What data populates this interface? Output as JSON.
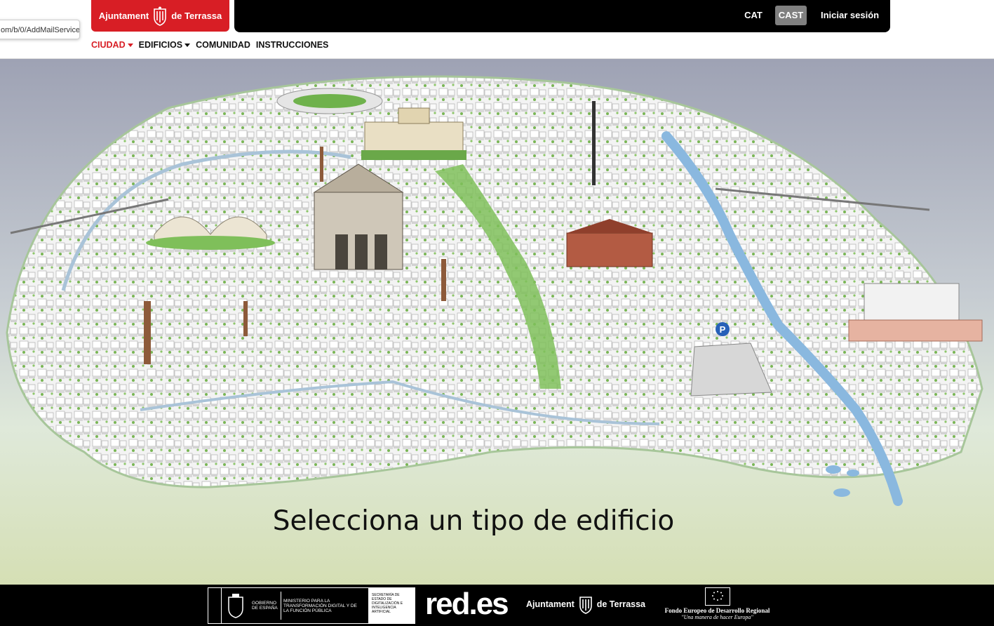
{
  "browser": {
    "status_url": "om/b/0/AddMailService"
  },
  "header": {
    "logo": {
      "left_text": "Ajuntament",
      "right_text": "de Terrassa",
      "color": "#d81e25"
    },
    "languages": [
      {
        "label": "CAT",
        "selected": false
      },
      {
        "label": "CAST",
        "selected": true
      }
    ],
    "login_label": "Iniciar sesión"
  },
  "nav": {
    "items": [
      {
        "label": "CIUDAD",
        "dropdown": true,
        "active": true
      },
      {
        "label": "EDIFICIOS",
        "dropdown": true,
        "active": false
      },
      {
        "label": "COMUNIDAD",
        "dropdown": false,
        "active": false
      },
      {
        "label": "INSTRUCCIONES",
        "dropdown": false,
        "active": false
      }
    ]
  },
  "map": {
    "description_icon": "illustrated-city-map",
    "prompt": "Selecciona un tipo de edificio",
    "parking_label": "P",
    "colors": {
      "sky": "#9fa4b6",
      "ground": "#dfe8d5",
      "river": "#8ab8df",
      "park": "#7fbf5a"
    }
  },
  "footer": {
    "gov_text": "Gobierno de España",
    "ministry_text": "Ministerio para la Transformación Digital y de la Función Pública",
    "secretary_text": "Secretaría de Estado de Digitalización e Inteligencia Artificial",
    "rede_logo": "red.es",
    "ajuntament_left": "Ajuntament",
    "ajuntament_right": "de Terrassa",
    "eu_small": "Unión Europea",
    "eu_fund": "Fondo Europeo de Desarrollo Regional",
    "eu_motto": "\"Una manera de hacer Europa\""
  }
}
